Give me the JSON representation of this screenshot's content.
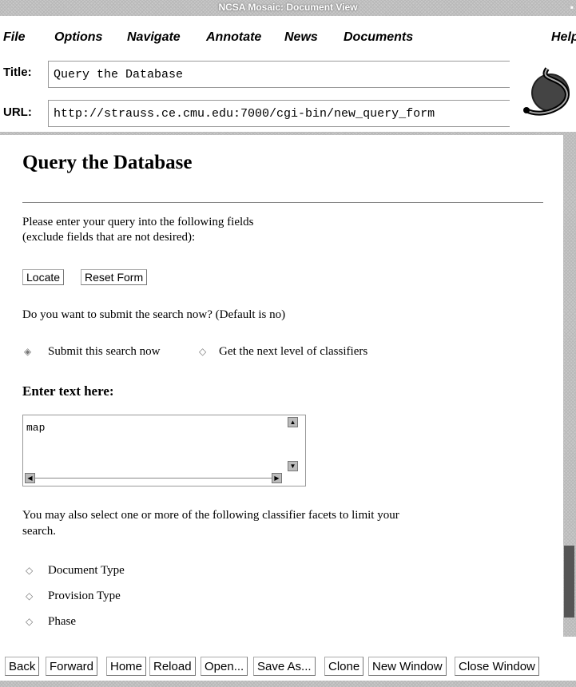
{
  "window": {
    "title": "NCSA Mosaic: Document View"
  },
  "menu": [
    {
      "label": "File"
    },
    {
      "label": "Options"
    },
    {
      "label": "Navigate"
    },
    {
      "label": "Annotate"
    },
    {
      "label": "News"
    },
    {
      "label": "Documents"
    },
    {
      "label": "Help"
    }
  ],
  "location": {
    "title_label": "Title:",
    "title_value": "Query the Database",
    "url_label": "URL:",
    "url_value": "http://strauss.ce.cmu.edu:7000/cgi-bin/new_query_form"
  },
  "document": {
    "heading": "Query the Database",
    "intro_line1": "Please enter your query into the following fields",
    "intro_line2": "(exclude fields that are not desired):",
    "locate_button": "Locate",
    "reset_button": "Reset Form",
    "submit_question": "Do you want to submit the search now? (Default is no)",
    "radio_submit": "Submit this search now",
    "radio_next": "Get the next level of classifiers",
    "enter_text_heading": "Enter text here:",
    "textarea_value": "map",
    "facets_line1": "You may also select one or more of the following classifier facets to limit your",
    "facets_line2": "search.",
    "facets": [
      "Document Type",
      "Provision Type",
      "Phase"
    ]
  },
  "footer_buttons": [
    "Back",
    "Forward",
    "Home",
    "Reload",
    "Open...",
    "Save As...",
    "Clone",
    "New Window",
    "Close Window"
  ]
}
